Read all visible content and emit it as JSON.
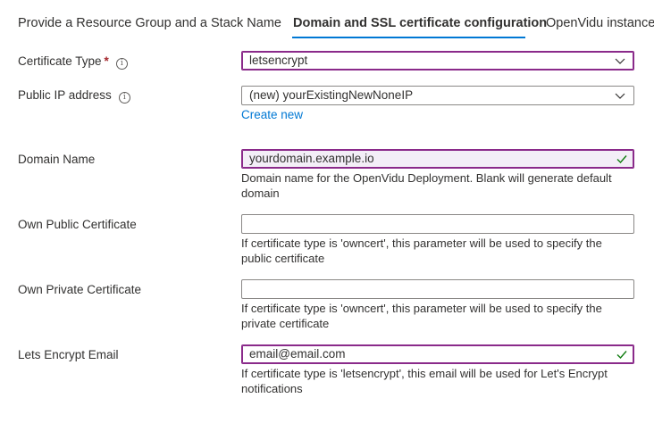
{
  "tabs": [
    {
      "label": "Provide a Resource Group and a Stack Name"
    },
    {
      "label": "Domain and SSL certificate configuration"
    },
    {
      "label": "OpenVidu instance"
    }
  ],
  "form": {
    "certificate_type": {
      "label": "Certificate Type",
      "required_mark": "*",
      "value": "letsencrypt",
      "info_icon": "i"
    },
    "public_ip": {
      "label": "Public IP address",
      "value": "(new) yourExistingNewNoneIP",
      "info_icon": "i",
      "link": "Create new"
    },
    "domain_name": {
      "label": "Domain Name",
      "value": "yourdomain.example.io",
      "help": "Domain name for the OpenVidu Deployment. Blank will generate default domain"
    },
    "own_public_cert": {
      "label": "Own Public Certificate",
      "value": "",
      "help": "If certificate type is 'owncert', this parameter will be used to specify the public certificate"
    },
    "own_private_cert": {
      "label": "Own Private Certificate",
      "value": "",
      "help": "If certificate type is 'owncert', this parameter will be used to specify the private certificate"
    },
    "lets_encrypt_email": {
      "label": "Lets Encrypt Email",
      "value": "email@email.com",
      "help": "If certificate type is 'letsencrypt', this email will be used for Let's Encrypt notifications"
    }
  },
  "icons": {
    "chevron": "chevron-down-icon",
    "check": "checkmark-icon",
    "info": "info-icon"
  },
  "colors": {
    "accent": "#0078d4",
    "focus_border": "#8a2a8a",
    "valid_check": "#107c10",
    "required": "#a4262c"
  }
}
